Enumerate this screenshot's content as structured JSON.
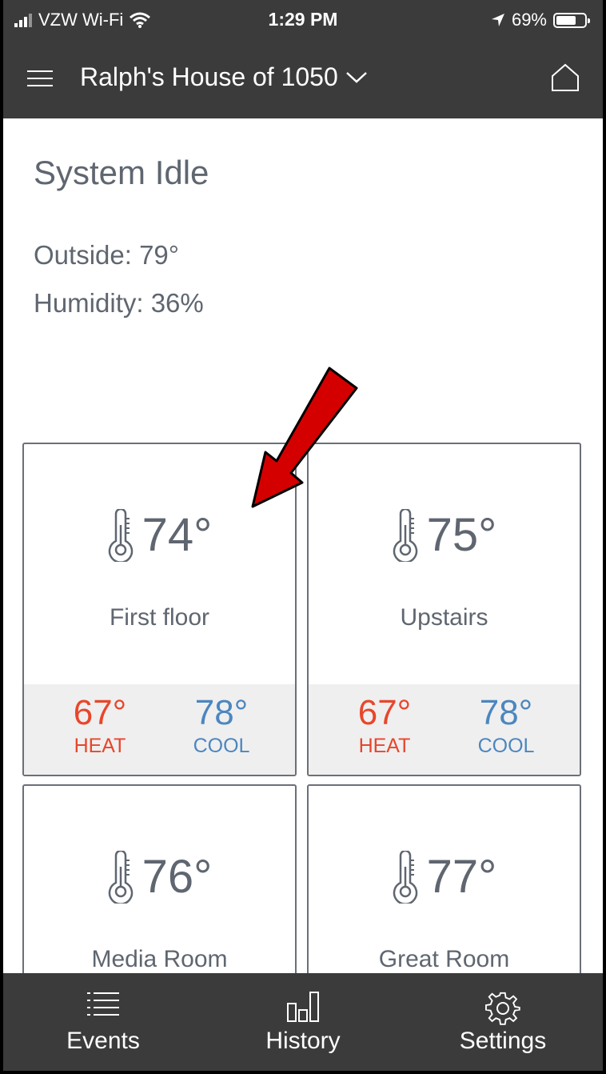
{
  "status_bar": {
    "carrier": "VZW Wi-Fi",
    "time": "1:29 PM",
    "battery": "69%",
    "battery_level": 0.69
  },
  "header": {
    "title": "Ralph's House of 1050"
  },
  "system": {
    "status": "System Idle",
    "outside": "Outside: 79°",
    "humidity": "Humidity: 36%"
  },
  "zones": [
    {
      "temp": "74°",
      "name": "First floor",
      "heat": "67°",
      "cool": "78°",
      "heat_label": "HEAT",
      "cool_label": "COOL"
    },
    {
      "temp": "75°",
      "name": "Upstairs",
      "heat": "67°",
      "cool": "78°",
      "heat_label": "HEAT",
      "cool_label": "COOL"
    },
    {
      "temp": "76°",
      "name": "Media Room"
    },
    {
      "temp": "77°",
      "name": "Great Room"
    }
  ],
  "nav": {
    "events": "Events",
    "history": "History",
    "settings": "Settings"
  },
  "colors": {
    "header_bg": "#3b3b3b",
    "heat": "#e8462b",
    "cool": "#4c86bf",
    "text": "#5f6670",
    "annotation_arrow": "#d40000"
  },
  "icons": [
    "signal-icon",
    "wifi-icon",
    "location-arrow-icon",
    "battery-icon",
    "menu-icon",
    "chevron-down-icon",
    "home-icon",
    "thermometer-icon",
    "events-list-icon",
    "history-bars-icon",
    "settings-gear-icon"
  ]
}
